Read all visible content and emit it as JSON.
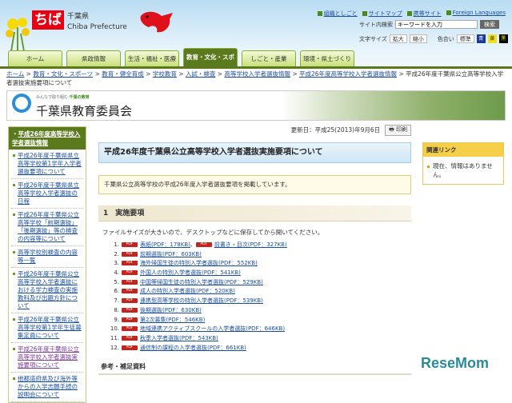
{
  "header": {
    "logo": "ちば",
    "pref_jp": "千葉県",
    "pref_en": "Chiba Prefecture",
    "top_links": [
      "組織としごと",
      "サイトマップ",
      "携帯サイト",
      "Foreign Languages"
    ],
    "search_label": "サイト内検索",
    "search_placeholder": "キーワードを入力",
    "search_button": "検索",
    "font_size_label": "文字サイズ",
    "font_larger": "拡大",
    "font_smaller": "縮小",
    "color_label": "色合い",
    "color_std": "標準",
    "color_blue": "青",
    "color_yellow": "黄",
    "color_black": "黒"
  },
  "nav": [
    "ホーム",
    "県政情報",
    "生活・福祉・医療",
    "教育・文化・スポーツ",
    "しごと・産業",
    "環境・県土づくり"
  ],
  "breadcrumb": [
    "ホーム",
    "教育・文化・スポーツ",
    "教育・健全育成",
    "学校教育",
    "入試・検査",
    "高等学校入学者選抜情報",
    "平成26年度高等学校入学者選抜情報"
  ],
  "breadcrumb_current": "平成26年度千葉県公立高等学校入学者選抜実施要項について",
  "banner": {
    "sub_a": "みんなで取り組む",
    "sub_b": "千葉の教育",
    "title": "千葉県教育委員会"
  },
  "sidebar": {
    "heading": "平成26年度高等学校入学者選抜情報",
    "items": [
      "平成26年度千葉県県立高等学校第1学年入学者選抜要項について",
      "平成26年度千葉県県立高等学校入学者選抜の日程",
      "平成26年度千葉県公立高等学校「前期選抜」「後期選抜」等の検査の内容等について",
      "高等学校別検査の内容等一覧",
      "平成26年度千葉県公立高等学校入学者選抜における学力検査の実施教科及び出題方針について",
      "平成26年度千葉県公立高等学校第1学年生徒募集定員について",
      "平成26年度千葉県公立高等学校入学者選抜実施要項について",
      "他都道府県及び海外等からの入学志願手続の説明会について"
    ]
  },
  "main": {
    "updated": "更新日：平成25(2013)年9月6日",
    "print": "印刷",
    "title": "平成26年度千葉県公立高等学校入学者選抜実施要項について",
    "notice": "千葉県公立高等学校の平成26年度入学者選抜要項を掲載しています。",
    "section1": "1　実施要項",
    "intro": "ファイルサイズが大きいので、デスクトップなどに保存してから開いてください。",
    "pdf_badge": "PDF",
    "files": [
      {
        "n": "1.",
        "label": "表紙(PDF：178KB)",
        "extra": "前書き・目次(PDF：327KB)"
      },
      {
        "n": "2.",
        "label": "前期選抜(PDF：603KB)"
      },
      {
        "n": "3.",
        "label": "海外帰国生徒の特別入学者選抜(PDF：552KB)"
      },
      {
        "n": "4.",
        "label": "外国人の特別入学者選抜(PDF：541KB)"
      },
      {
        "n": "5.",
        "label": "中国等帰国生徒の特別入学者選抜(PDF：529KB)"
      },
      {
        "n": "6.",
        "label": "成人の特別入学者選抜(PDF：520KB)"
      },
      {
        "n": "7.",
        "label": "連携型高等学校の特別入学者選抜(PDF：539KB)"
      },
      {
        "n": "8.",
        "label": "後期選抜(PDF：630KB)"
      },
      {
        "n": "9.",
        "label": "第2次募集(PDF：546KB)"
      },
      {
        "n": "10.",
        "label": "地域連携アクティブスクールの入学者選抜(PDF：646KB)"
      },
      {
        "n": "11.",
        "label": "秋季入学者選抜(PDF：543KB)"
      },
      {
        "n": "12.",
        "label": "通信制の課程の入学者選抜(PDF：661KB)"
      }
    ],
    "ref_heading": "参考・補足資料"
  },
  "right": {
    "heading": "関連リンク",
    "text": "現在、情報はありません。"
  },
  "watermark": "ReseMom"
}
